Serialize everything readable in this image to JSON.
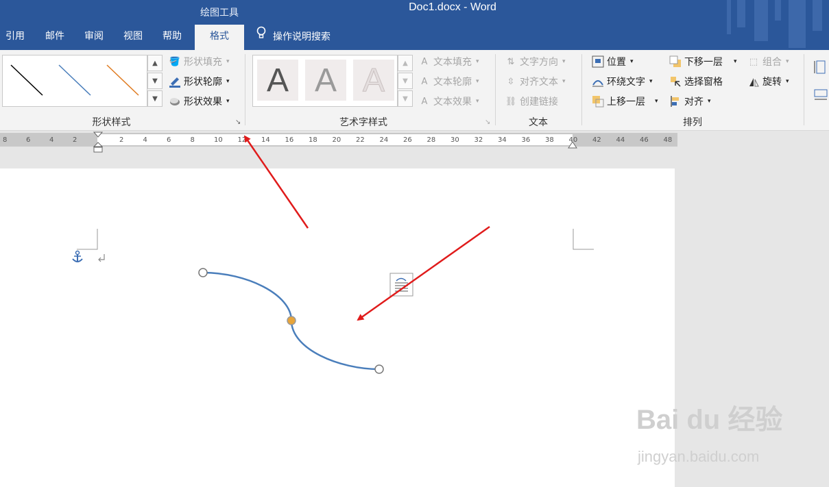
{
  "window": {
    "title": "Doc1.docx  -  Word",
    "contextual_group": "绘图工具"
  },
  "tabs": [
    {
      "label": "引用"
    },
    {
      "label": "邮件"
    },
    {
      "label": "审阅"
    },
    {
      "label": "视图"
    },
    {
      "label": "帮助"
    },
    {
      "label": "格式",
      "active": true
    }
  ],
  "tell_me": {
    "label": "操作说明搜索",
    "icon": "lightbulb-icon"
  },
  "ribbon": {
    "shape_styles": {
      "label": "形状样式",
      "gallery_line_colors": [
        "#000000",
        "#4a7ebb",
        "#e07b20"
      ],
      "fill": "形状填充",
      "outline": "形状轮廓",
      "effects": "形状效果"
    },
    "wordart_styles": {
      "label": "艺术字样式",
      "gallery_letter": "A",
      "text_fill": "文本填充",
      "text_outline": "文本轮廓",
      "text_effects": "文本效果"
    },
    "text": {
      "label": "文本",
      "direction": "文字方向",
      "align": "对齐文本",
      "link": "创建链接"
    },
    "arrange": {
      "label": "排列",
      "position": "位置",
      "wrap": "环绕文字",
      "bring_forward": "上移一层",
      "send_backward": "下移一层",
      "selection_pane": "选择窗格",
      "align": "对齐",
      "group": "组合",
      "rotate": "旋转"
    }
  },
  "ruler": {
    "left_ticks": [
      "8",
      "6",
      "4",
      "2"
    ],
    "ticks": [
      "2",
      "4",
      "6",
      "8",
      "10",
      "12",
      "14",
      "16",
      "18",
      "20",
      "22",
      "24",
      "26",
      "28",
      "30",
      "32",
      "34",
      "36",
      "38",
      "40",
      "42",
      "44",
      "46",
      "48"
    ]
  },
  "colors": {
    "accent": "#2b579a",
    "curve": "#4a7ebb",
    "arrow": "#e01b1b",
    "handle_mid": "#e8a53a"
  },
  "watermark": {
    "logo": "Bai du 经验",
    "url": "jingyan.baidu.com"
  }
}
